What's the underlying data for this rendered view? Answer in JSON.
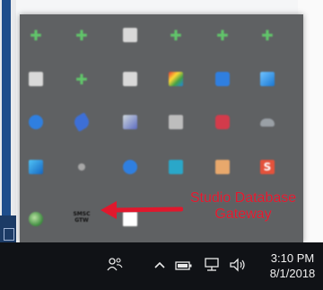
{
  "callout": {
    "line1": "Studio Database",
    "line2": "Gateway",
    "color": "#e0182d"
  },
  "gateway_icon": {
    "text_top": "SMSC",
    "text_bottom": "GTW"
  },
  "tray_icons": [
    "green-plus-icon",
    "green-plus-icon",
    "grey-window-icon",
    "green-plus-icon",
    "green-plus-icon",
    "green-plus-icon",
    "grey-window-icon",
    "green-plus-icon",
    "grey-window-icon",
    "colorful-app-icon",
    "blue-shield-icon",
    "blue-app-icon",
    "bluetooth-icon",
    "link-icon",
    "image-app-icon",
    "grey-app-icon",
    "red-app-icon",
    "cloud-icon",
    "blue-app-icon",
    "grey-dot-icon",
    "blue-app-icon",
    "teal-app-icon",
    "folder-icon",
    "orange-s-icon",
    "globe-icon",
    "database-gateway-icon",
    "white-app-icon"
  ],
  "taskbar": {
    "time": "3:10 PM",
    "date": "8/1/2018",
    "icons": [
      "people-icon",
      "chevron-up-icon",
      "battery-icon",
      "network-icon",
      "volume-icon"
    ],
    "background": "#101216"
  }
}
